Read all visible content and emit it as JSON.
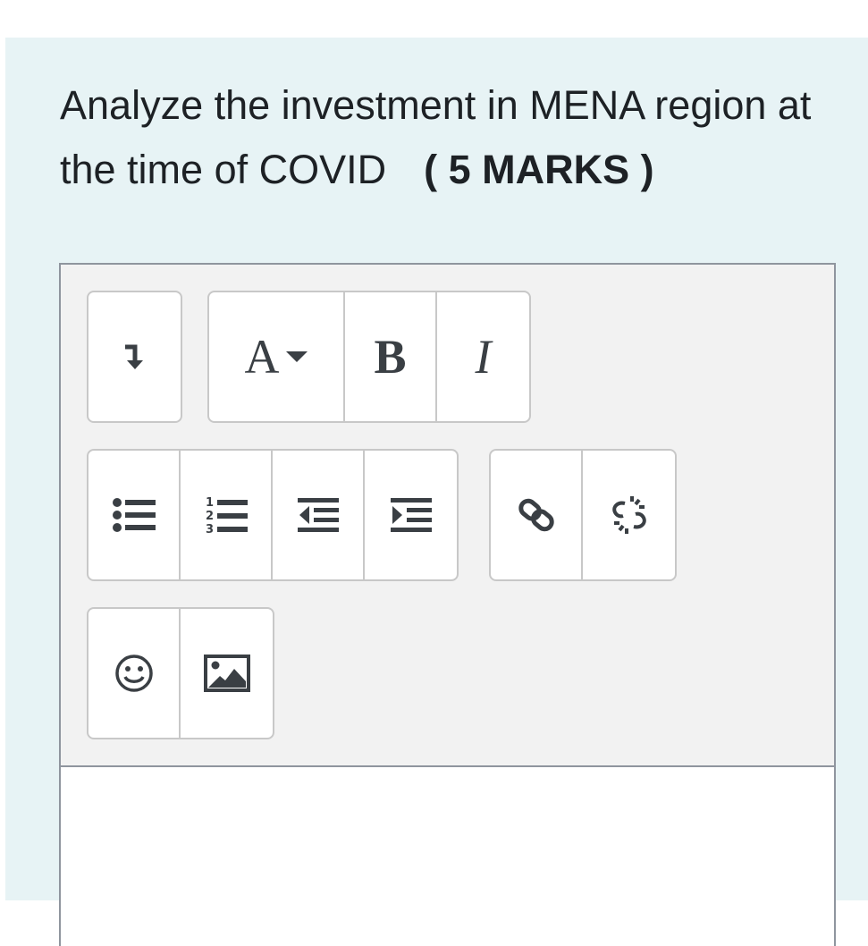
{
  "question": {
    "text": "Analyze the investment in MENA region at the time of COVID",
    "marks": "( 5 MARKS )"
  },
  "toolbar": {
    "groups": [
      {
        "buttons": [
          {
            "icon": "collapse-toolbar-icon"
          }
        ]
      },
      {
        "buttons": [
          {
            "icon": "font-style-dropdown-icon",
            "label": "A"
          },
          {
            "icon": "bold-icon",
            "label": "B"
          },
          {
            "icon": "italic-icon",
            "label": "I"
          }
        ]
      },
      {
        "buttons": [
          {
            "icon": "unordered-list-icon"
          },
          {
            "icon": "ordered-list-icon"
          },
          {
            "icon": "outdent-icon"
          },
          {
            "icon": "indent-icon"
          }
        ]
      },
      {
        "buttons": [
          {
            "icon": "link-icon"
          },
          {
            "icon": "unlink-icon"
          }
        ]
      },
      {
        "buttons": [
          {
            "icon": "emoji-icon"
          },
          {
            "icon": "image-icon"
          }
        ]
      }
    ]
  },
  "colors": {
    "panel_bg": "#e7f3f5",
    "toolbar_bg": "#f2f2f2",
    "icon": "#3a3f44",
    "border": "#8f959e"
  }
}
